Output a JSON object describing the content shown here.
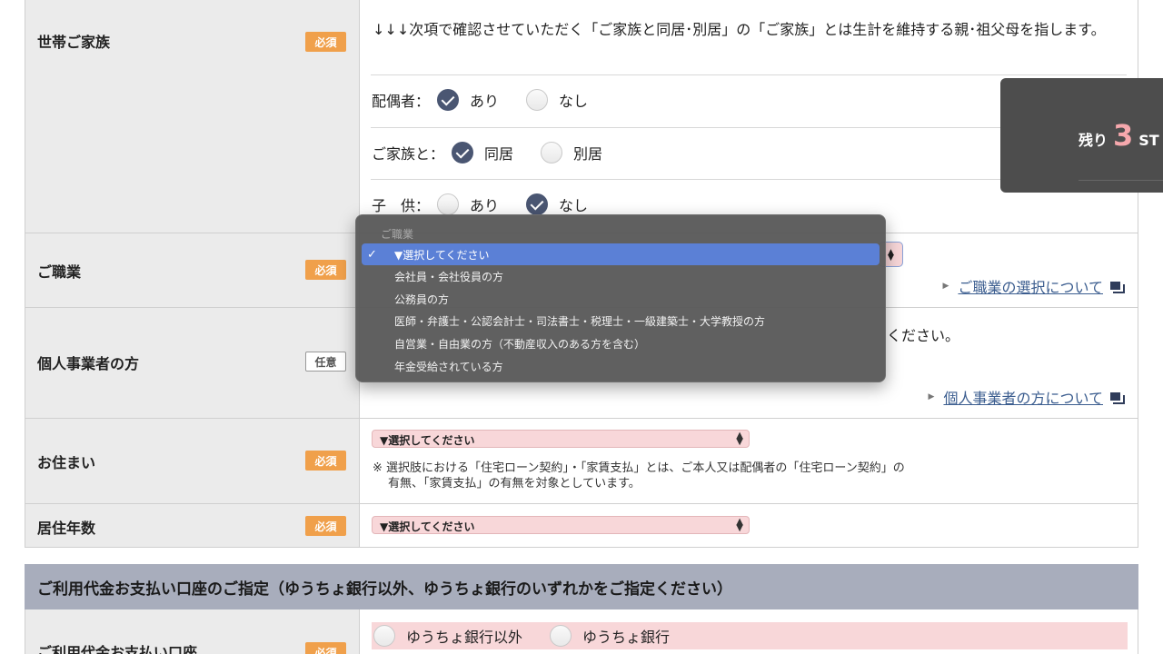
{
  "household": {
    "label": "世帯ご家族",
    "badge": "必須",
    "note": "↓↓↓次項で確認させていただく「ご家族と同居･別居」の「ご家族」とは生計を維持する親･祖父母を指します。",
    "spouse": {
      "question": "配偶者：",
      "opt1": "あり",
      "opt2": "なし"
    },
    "family": {
      "question": "ご家族と：",
      "opt1": "同居",
      "opt2": "別居"
    },
    "children": {
      "question": "子　供：",
      "opt1": "あり",
      "opt2": "なし"
    }
  },
  "occupation": {
    "label": "ご職業",
    "badge": "必須",
    "link": "ご職業の選択について"
  },
  "self_employed": {
    "label": "個人事業者の方",
    "badge": "任意",
    "text_tail": "ください。",
    "link": "個人事業者の方について"
  },
  "residence": {
    "label": "お住まい",
    "badge": "必須",
    "select_value": "▼選択してください",
    "note_line1": "※ 選択肢における「住宅ローン契約」・「家賃支払」とは、ご本人又は配偶者の「住宅ローン契約」の",
    "note_line2": "有無、「家賃支払」の有無を対象としています。"
  },
  "years": {
    "label": "居住年数",
    "badge": "必須",
    "select_value": "▼選択してください"
  },
  "payment": {
    "section_title": "ご利用代金お支払い口座のご指定（ゆうちょ銀行以外、ゆうちょ銀行のいずれかをご指定ください）",
    "label": "ご利用代金お支払い口座",
    "badge": "必須",
    "opt1": "ゆうちょ銀行以外",
    "opt2": "ゆうちょ銀行"
  },
  "dropdown": {
    "group": "ご職業",
    "items": [
      "▼選択してください",
      "会社員・会社役員の方",
      "公務員の方",
      "医師・弁護士・公認会計士・司法書士・税理士・一級建築士・大学教授の方",
      "自営業・自由業の方（不動産収入のある方を含む）",
      "年金受給されている方"
    ]
  },
  "floating": {
    "prefix": "残り",
    "number": "3",
    "suffix": "ST"
  }
}
